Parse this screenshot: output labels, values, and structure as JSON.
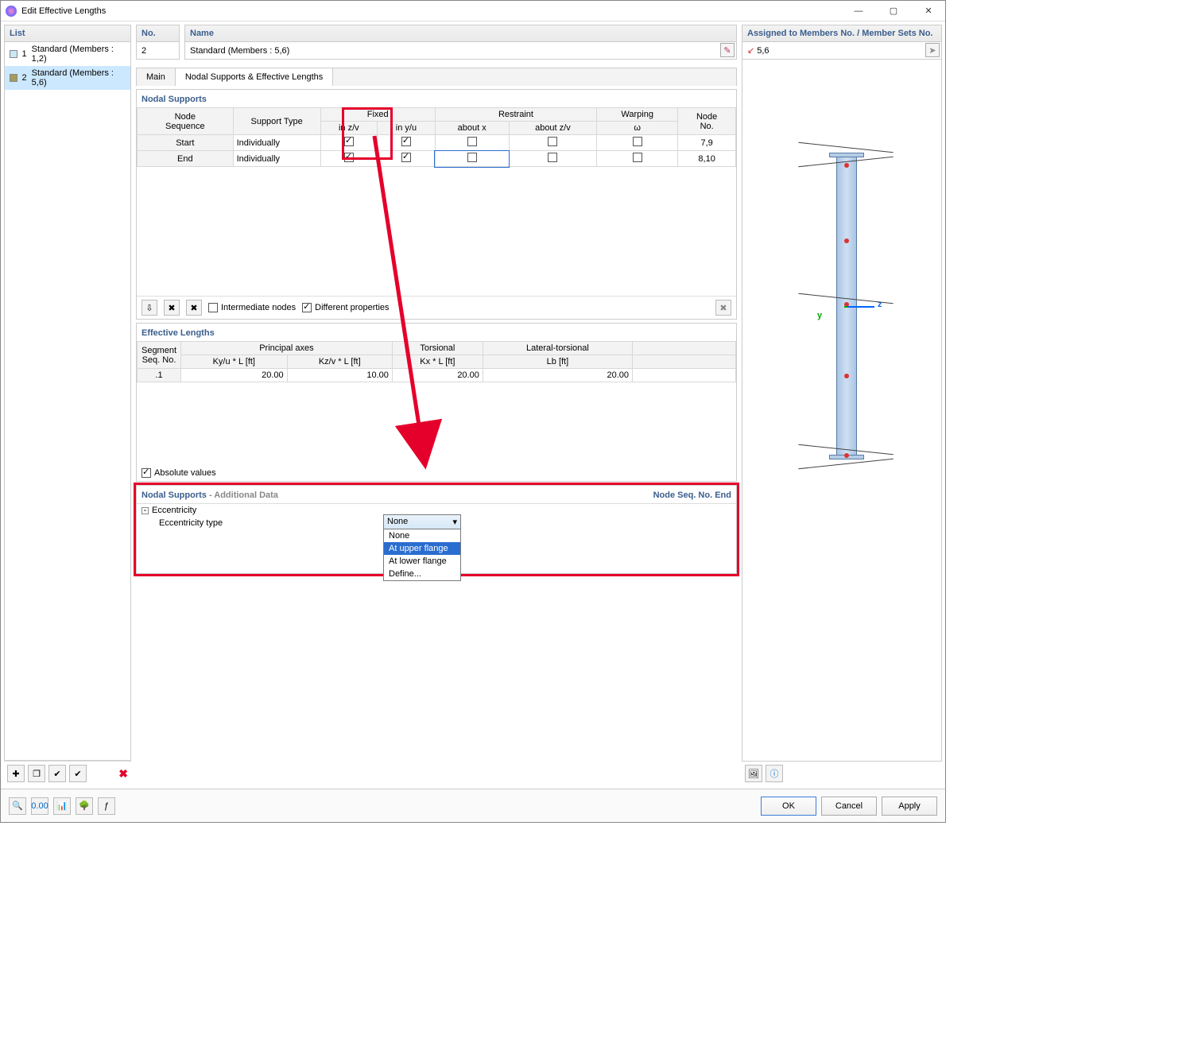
{
  "window": {
    "title": "Edit Effective Lengths"
  },
  "left": {
    "header": "List",
    "items": [
      {
        "num": "1",
        "label": "Standard (Members : 1,2)",
        "color": "#c9e8f2"
      },
      {
        "num": "2",
        "label": "Standard (Members : 5,6)",
        "color": "#a39c5c"
      }
    ]
  },
  "no": {
    "header": "No.",
    "value": "2"
  },
  "name": {
    "header": "Name",
    "value": "Standard (Members : 5,6)"
  },
  "assigned": {
    "header": "Assigned to Members No. / Member Sets No.",
    "value": "5,6",
    "icon": "↙"
  },
  "tabs": {
    "a": "Main",
    "b": "Nodal Supports & Effective Lengths"
  },
  "nodal": {
    "title": "Nodal Supports",
    "cols": {
      "seq": "Node\nSequence",
      "support": "Support Type",
      "fixed": "Fixed",
      "zv": "in z/v",
      "yu": "in y/u",
      "restraint": "Restraint",
      "ax": "about x",
      "azv": "about z/v",
      "warp": "Warping",
      "omega": "ω",
      "node": "Node\nNo."
    },
    "rows": [
      {
        "seq": "Start",
        "type": "Individually",
        "zv": true,
        "yu": true,
        "ax": false,
        "azv": false,
        "w": false,
        "node": "7,9"
      },
      {
        "seq": "End",
        "type": "Individually",
        "zv": true,
        "yu": true,
        "ax": false,
        "azv": false,
        "w": false,
        "node": "8,10"
      }
    ],
    "intermediate": "Intermediate nodes",
    "diffprops": "Different properties"
  },
  "eff": {
    "title": "Effective Lengths",
    "seq": "Segment\nSeq. No.",
    "principal": "Principal axes",
    "ky": "Ky/u * L [ft]",
    "kz": "Kz/v * L [ft]",
    "torsional": "Torsional",
    "kx": "Kx * L [ft]",
    "lt": "Lateral-torsional",
    "lb": "Lb [ft]",
    "row": {
      "seq": ".1",
      "ky": "20.00",
      "kz": "10.00",
      "kx": "20.00",
      "lb": "20.00"
    },
    "abs": "Absolute values"
  },
  "addl": {
    "title1": "Nodal Supports",
    "title2": " - Additional Data",
    "right": "Node Seq. No. End",
    "ecc": "Eccentricity",
    "etype": "Eccentricity type",
    "selected": "None",
    "opts": {
      "a": "None",
      "b": "At upper flange",
      "c": "At lower flange",
      "d": "Define..."
    }
  },
  "axes": {
    "y": "y",
    "z": "z"
  },
  "buttons": {
    "ok": "OK",
    "cancel": "Cancel",
    "apply": "Apply"
  }
}
